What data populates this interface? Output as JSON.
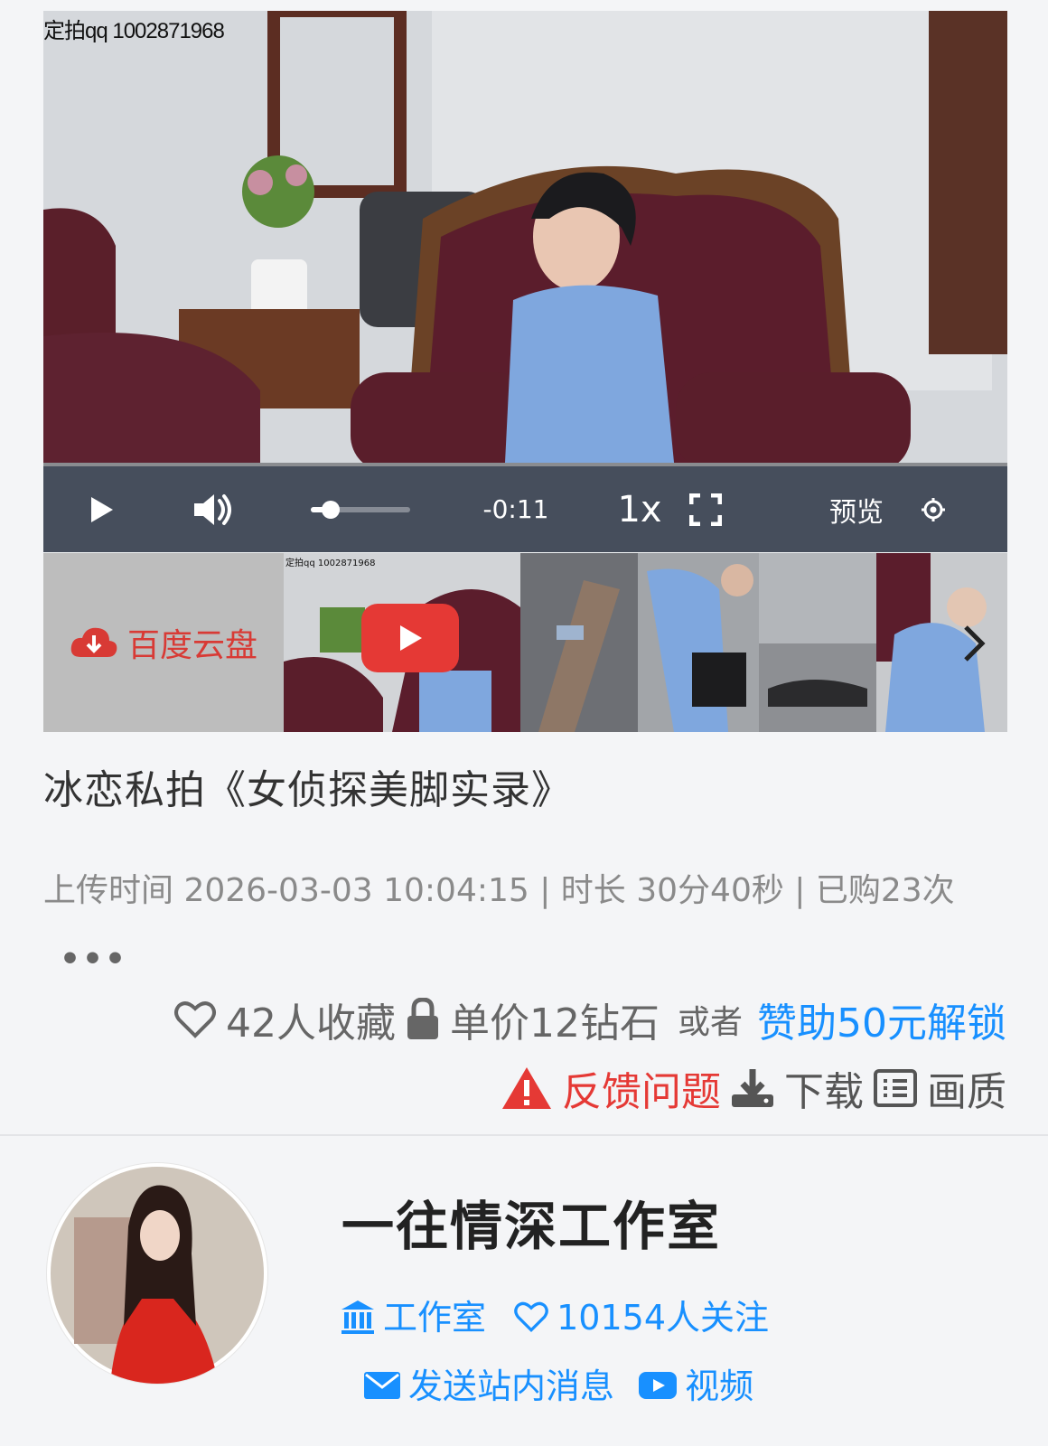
{
  "video": {
    "watermark": "定拍qq 1002871968",
    "controls": {
      "play_icon": "play-icon",
      "volume_icon": "volume-icon",
      "seek_progress": 0.2,
      "time": "-0:11",
      "speed": "1x",
      "fullscreen_icon": "fullscreen-icon",
      "preview": "预览",
      "settings_icon": "settings-icon"
    }
  },
  "thumbnails": {
    "baidu_label": "百度云盘",
    "baidu_icon": "cloud-download-icon",
    "thumb_watermark": "定拍qq 1002871968",
    "play_icon": "youtube-play-icon",
    "next_icon": "chevron-right-icon"
  },
  "title": "冰恋私拍《女侦探美脚实录》",
  "meta": {
    "text": "上传时间 2026-03-03 10:04:15 | 时长 30分40秒 | 已购23次",
    "more": "•••"
  },
  "actions": {
    "favorites": "42人收藏",
    "price": "单价12钻石",
    "or": "或者",
    "unlock": "赞助50元解锁",
    "feedback": "反馈问题",
    "download": "下载",
    "quality": "画质"
  },
  "studio": {
    "name": "一往情深工作室",
    "type": "工作室",
    "followers": "10154人关注",
    "message": "发送站内消息",
    "videos": "视频"
  },
  "colors": {
    "accent": "#1890ff",
    "danger": "#e53935",
    "baidu": "#d83a35"
  }
}
